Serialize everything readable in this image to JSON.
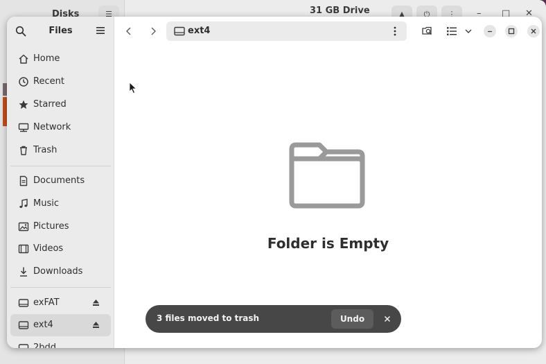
{
  "background_window": {
    "title_left": "Disks",
    "title": "31 GB Drive"
  },
  "sidebar": {
    "title": "Files",
    "items": [
      {
        "label": "Home",
        "icon": "home-icon"
      },
      {
        "label": "Recent",
        "icon": "clock-icon"
      },
      {
        "label": "Starred",
        "icon": "star-icon"
      },
      {
        "label": "Network",
        "icon": "network-icon"
      },
      {
        "label": "Trash",
        "icon": "trash-icon"
      },
      {
        "label": "Documents",
        "icon": "document-icon"
      },
      {
        "label": "Music",
        "icon": "music-icon"
      },
      {
        "label": "Pictures",
        "icon": "picture-icon"
      },
      {
        "label": "Videos",
        "icon": "video-icon"
      },
      {
        "label": "Downloads",
        "icon": "download-icon"
      },
      {
        "label": "exFAT",
        "icon": "drive-icon",
        "eject": true
      },
      {
        "label": "ext4",
        "icon": "drive-icon",
        "eject": true,
        "active": true
      },
      {
        "label": "2bdd",
        "icon": "drive-icon"
      }
    ]
  },
  "header": {
    "path": "ext4"
  },
  "main": {
    "empty_title": "Folder is Empty"
  },
  "toast": {
    "message": "3 files moved to trash",
    "undo_label": "Undo"
  },
  "colors": {
    "accent": "#c0501f",
    "toast_bg": "#474747",
    "sidebar_bg": "#ebebeb"
  }
}
